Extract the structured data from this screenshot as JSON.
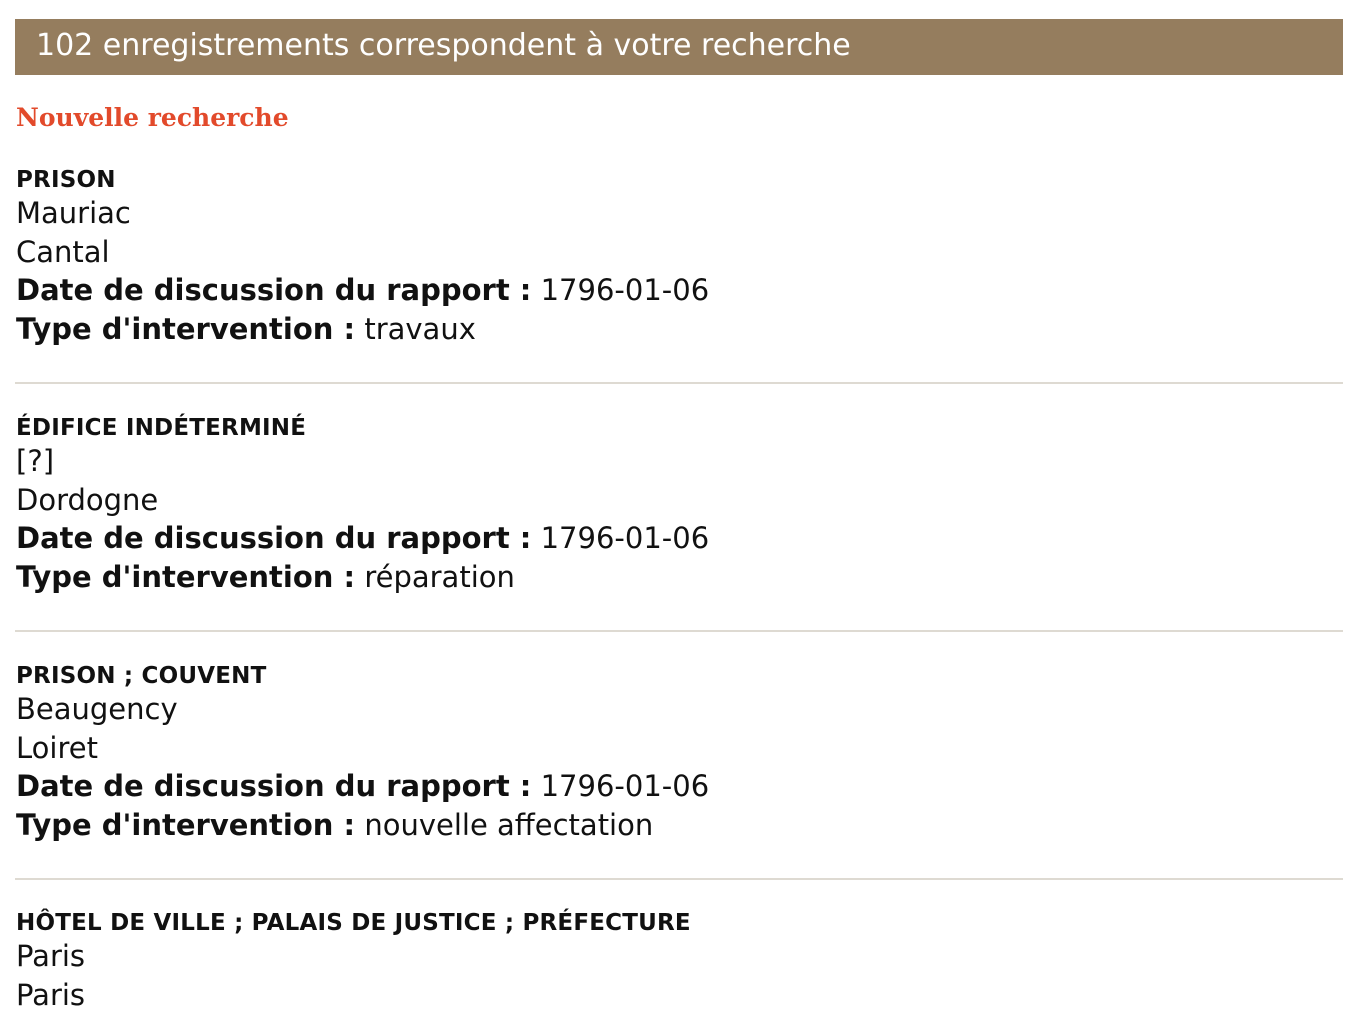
{
  "header": {
    "results_text": "102 enregistrements correspondent à votre recherche"
  },
  "new_search_label": "Nouvelle recherche",
  "field_labels": {
    "date_label": "Date de discussion du rapport :",
    "type_label": "Type d'intervention :"
  },
  "records": [
    {
      "type": "PRISON",
      "place": "Mauriac",
      "department": "Cantal",
      "date": "1796-01-06",
      "intervention": "travaux"
    },
    {
      "type": "ÉDIFICE INDÉTERMINÉ",
      "place": "[?]",
      "department": "Dordogne",
      "date": "1796-01-06",
      "intervention": "réparation"
    },
    {
      "type": "PRISON ; COUVENT",
      "place": "Beaugency",
      "department": "Loiret",
      "date": "1796-01-06",
      "intervention": "nouvelle affectation"
    },
    {
      "type": "HÔTEL DE VILLE ; PALAIS DE JUSTICE ; PRÉFECTURE",
      "place": "Paris",
      "department": "Paris"
    }
  ],
  "colors": {
    "header_background": "#957d5e",
    "header_text": "#ffffff",
    "link": "#e24a2b",
    "divider": "#dedad2"
  }
}
